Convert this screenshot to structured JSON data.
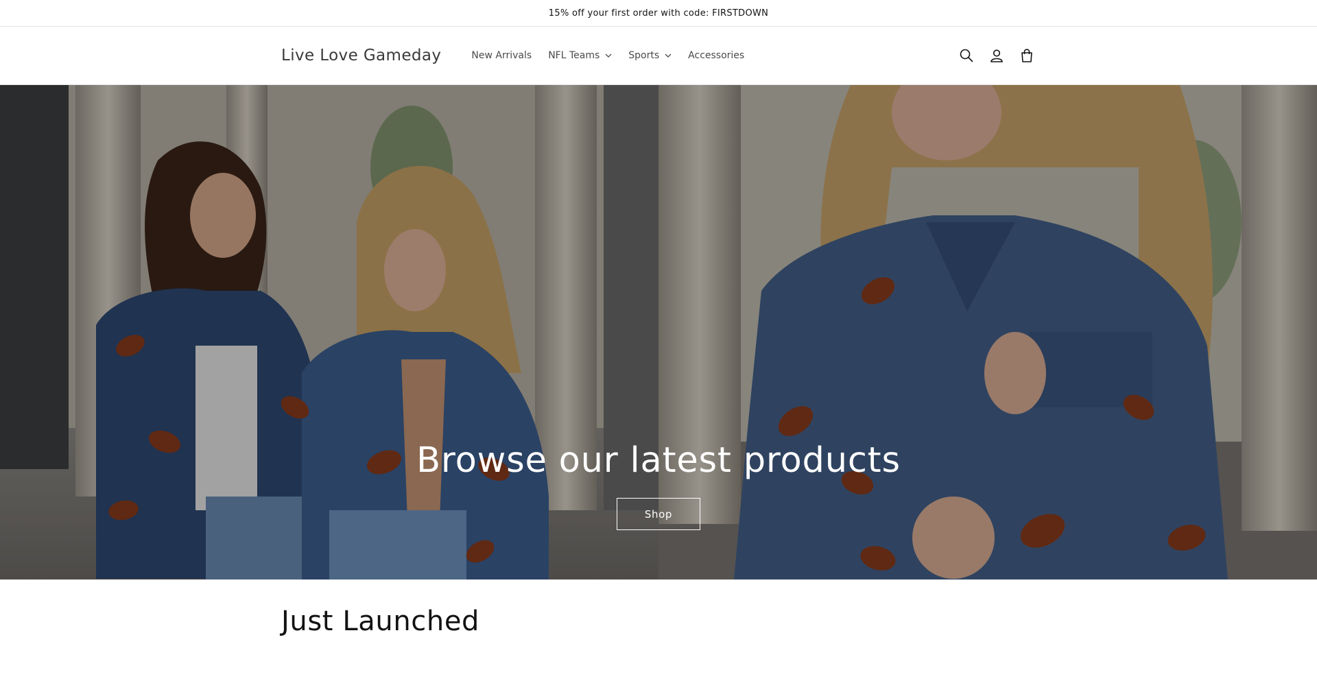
{
  "announcement": {
    "text": "15% off your first order with code: FIRSTDOWN"
  },
  "header": {
    "logo": "Live Love Gameday",
    "nav": [
      {
        "label": "New Arrivals",
        "has_dropdown": false
      },
      {
        "label": "NFL Teams",
        "has_dropdown": true
      },
      {
        "label": "Sports",
        "has_dropdown": true
      },
      {
        "label": "Accessories",
        "has_dropdown": false
      }
    ],
    "icons": [
      "search-icon",
      "account-icon",
      "cart-icon"
    ]
  },
  "hero": {
    "title": "Browse our latest products",
    "button_label": "Shop",
    "images": [
      "two women in denim football-sequin jackets",
      "woman in denim football-sequin jacket"
    ]
  },
  "section": {
    "title": "Just Launched"
  },
  "colors": {
    "text": "#121212",
    "nav_text": "#4a4a4a",
    "border": "#e6e6e6",
    "hero_text": "#ffffff",
    "denim": "#44618a",
    "football": "#8a3b1c"
  }
}
